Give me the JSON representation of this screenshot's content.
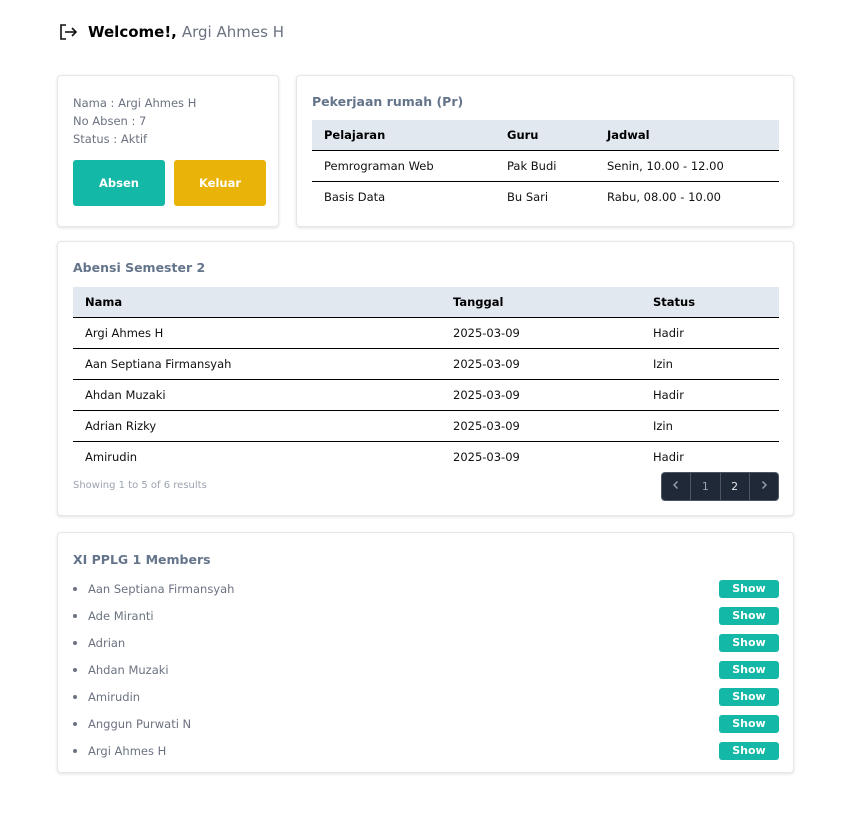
{
  "header": {
    "icon": "logout-icon",
    "welcome": "Welcome!,",
    "name": "Argi Ahmes H"
  },
  "profile": {
    "nama": "Nama : Argi Ahmes H",
    "no_absen": "No Absen : 7",
    "status": "Status : Aktif",
    "absen_label": "Absen",
    "keluar_label": "Keluar"
  },
  "homework": {
    "title": "Pekerjaan rumah (Pr)",
    "headers": [
      "Pelajaran",
      "Guru",
      "Jadwal"
    ],
    "rows": [
      [
        "Pemrograman Web",
        "Pak Budi",
        "Senin, 10.00 - 12.00"
      ],
      [
        "Basis Data",
        "Bu Sari",
        "Rabu, 08.00 - 10.00"
      ]
    ]
  },
  "attendance": {
    "title": "Abensi Semester 2",
    "headers": [
      "Nama",
      "Tanggal",
      "Status"
    ],
    "rows": [
      [
        "Argi Ahmes H",
        "2025-03-09",
        "Hadir"
      ],
      [
        "Aan Septiana Firmansyah",
        "2025-03-09",
        "Izin"
      ],
      [
        "Ahdan Muzaki",
        "2025-03-09",
        "Hadir"
      ],
      [
        "Adrian Rizky",
        "2025-03-09",
        "Izin"
      ],
      [
        "Amirudin",
        "2025-03-09",
        "Hadir"
      ]
    ],
    "showing": "Showing 1 to 5 of 6 results",
    "pagination": {
      "prev_icon": "chevron-left-icon",
      "pages": [
        "1",
        "2"
      ],
      "current_page": "2",
      "next_icon": "chevron-right-icon"
    }
  },
  "members": {
    "title": "XI PPLG 1 Members",
    "show_label": "Show",
    "items": [
      "Aan Septiana Firmansyah",
      "Ade Miranti",
      "Adrian",
      "Ahdan Muzaki",
      "Amirudin",
      "Anggun Purwati N",
      "Argi Ahmes H"
    ]
  },
  "colors": {
    "primary_button": "#14b8a6",
    "warning_button": "#eab308",
    "table_header_bg": "#e2e8f0",
    "pagination_bg": "#1f2937"
  }
}
